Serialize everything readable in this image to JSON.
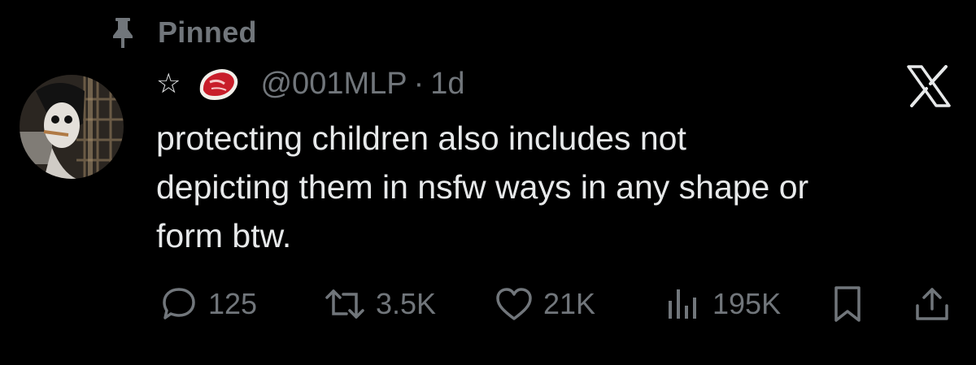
{
  "pinned": {
    "label": "Pinned",
    "icon": "pin-icon"
  },
  "tweet": {
    "star": "☆",
    "badge_icon": "steak-emoji-icon",
    "handle": "@001MLP",
    "separator": "·",
    "time": "1d",
    "text_lines": [
      "protecting children also includes not",
      "depicting them in nsfw ways in any shape or",
      "form btw."
    ]
  },
  "actions": {
    "replies": {
      "icon": "reply-icon",
      "count": "125"
    },
    "reposts": {
      "icon": "repost-icon",
      "count": "3.5K"
    },
    "likes": {
      "icon": "heart-icon",
      "count": "21K"
    },
    "views": {
      "icon": "views-icon",
      "count": "195K"
    },
    "bookmark": {
      "icon": "bookmark-icon"
    },
    "share": {
      "icon": "share-icon"
    }
  },
  "colors": {
    "background": "#000000",
    "text": "#e7e9ea",
    "secondary": "#71767b"
  }
}
